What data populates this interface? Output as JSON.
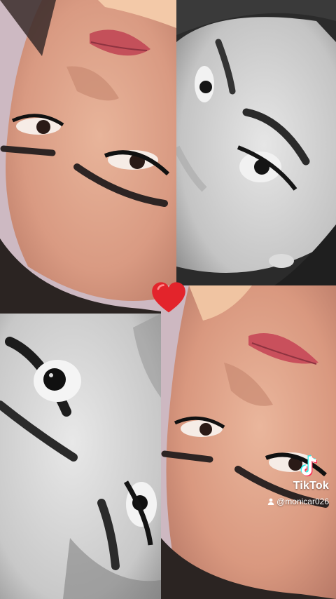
{
  "watermark": {
    "brand": "TikTok",
    "username": "@monicar026",
    "logo_icon": "tiktok-logo-icon",
    "user_icon": "person-icon"
  },
  "overlay": {
    "sticker_icon": "red-heart-icon"
  },
  "panels": [
    {
      "name": "photo-panel-top-left",
      "tone": "color"
    },
    {
      "name": "photo-panel-top-right",
      "tone": "grayscale"
    },
    {
      "name": "photo-panel-bottom-left",
      "tone": "grayscale"
    },
    {
      "name": "photo-panel-bottom-right",
      "tone": "color"
    }
  ],
  "colors": {
    "heart": "#e3242b",
    "tiktok_cyan": "#25f4ee",
    "tiktok_red": "#fe2c55"
  }
}
